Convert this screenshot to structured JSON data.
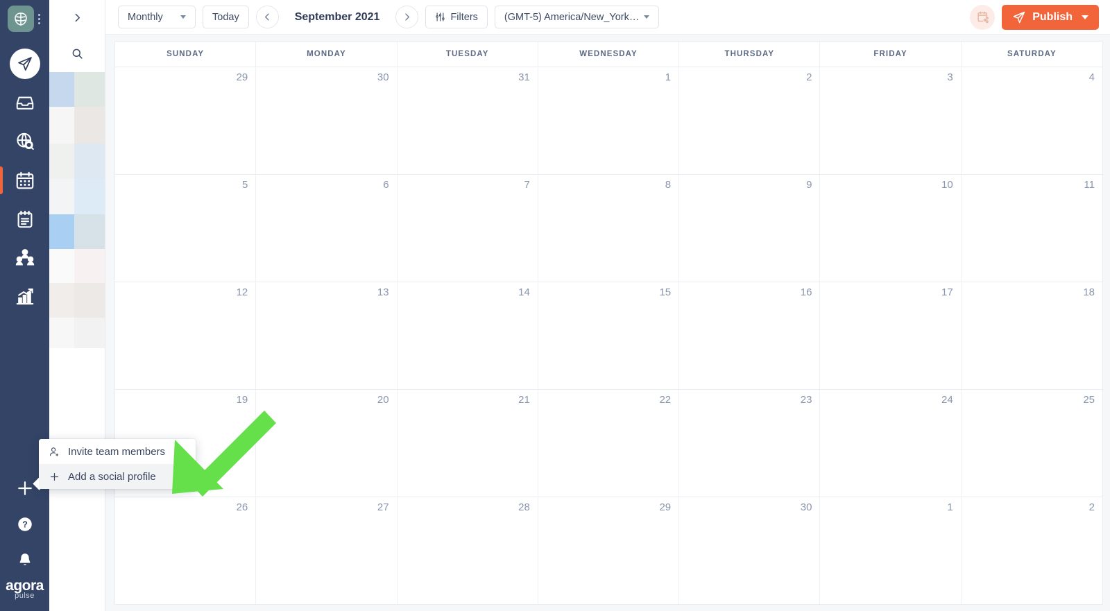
{
  "brand": {
    "logo_tile_color": "#6e9490",
    "wordmark_line1": "agora",
    "wordmark_line2": "pulse",
    "rail_bg": "#334466",
    "accent": "#f2653b",
    "annotation_arrow_color": "#66e04a"
  },
  "rail": {
    "items": [
      {
        "name": "publishing-icon",
        "label": "Publishing",
        "active": false
      },
      {
        "name": "inbox-icon",
        "label": "Inbox",
        "active": false
      },
      {
        "name": "listening-icon",
        "label": "Listening",
        "active": false
      },
      {
        "name": "calendar-icon",
        "label": "Calendar",
        "active": true
      },
      {
        "name": "reports-icon",
        "label": "Content",
        "active": false
      },
      {
        "name": "team-icon",
        "label": "Team",
        "active": false
      },
      {
        "name": "analytics-icon",
        "label": "Analytics",
        "active": false
      }
    ],
    "bottom": [
      {
        "name": "add-icon",
        "label": "Add"
      },
      {
        "name": "help-icon",
        "label": "Help"
      },
      {
        "name": "notifications-icon",
        "label": "Notifications"
      }
    ]
  },
  "profiles_panel": {
    "collapse_label": "Expand panel",
    "search_label": "Search profiles"
  },
  "toolbar": {
    "view_select": "Monthly",
    "today_button": "Today",
    "prev_label": "Previous month",
    "next_label": "Next month",
    "month_title": "September 2021",
    "filters_button": "Filters",
    "timezone_select": "(GMT-5) America/New_York…",
    "share_calendar_label": "Share calendar",
    "publish_button": "Publish"
  },
  "calendar": {
    "day_headers": [
      "SUNDAY",
      "MONDAY",
      "TUESDAY",
      "WEDNESDAY",
      "THURSDAY",
      "FRIDAY",
      "SATURDAY"
    ],
    "weeks": [
      [
        "29",
        "30",
        "31",
        "1",
        "2",
        "3",
        "4"
      ],
      [
        "5",
        "6",
        "7",
        "8",
        "9",
        "10",
        "11"
      ],
      [
        "12",
        "13",
        "14",
        "15",
        "16",
        "17",
        "18"
      ],
      [
        "19",
        "20",
        "21",
        "22",
        "23",
        "24",
        "25"
      ],
      [
        "26",
        "27",
        "28",
        "29",
        "30",
        "1",
        "2"
      ]
    ]
  },
  "popup_menu": {
    "items": [
      {
        "icon": "person-plus-icon",
        "label": "Invite team members",
        "highlighted": false
      },
      {
        "icon": "plus-icon",
        "label": "Add a social profile",
        "highlighted": true
      }
    ]
  }
}
